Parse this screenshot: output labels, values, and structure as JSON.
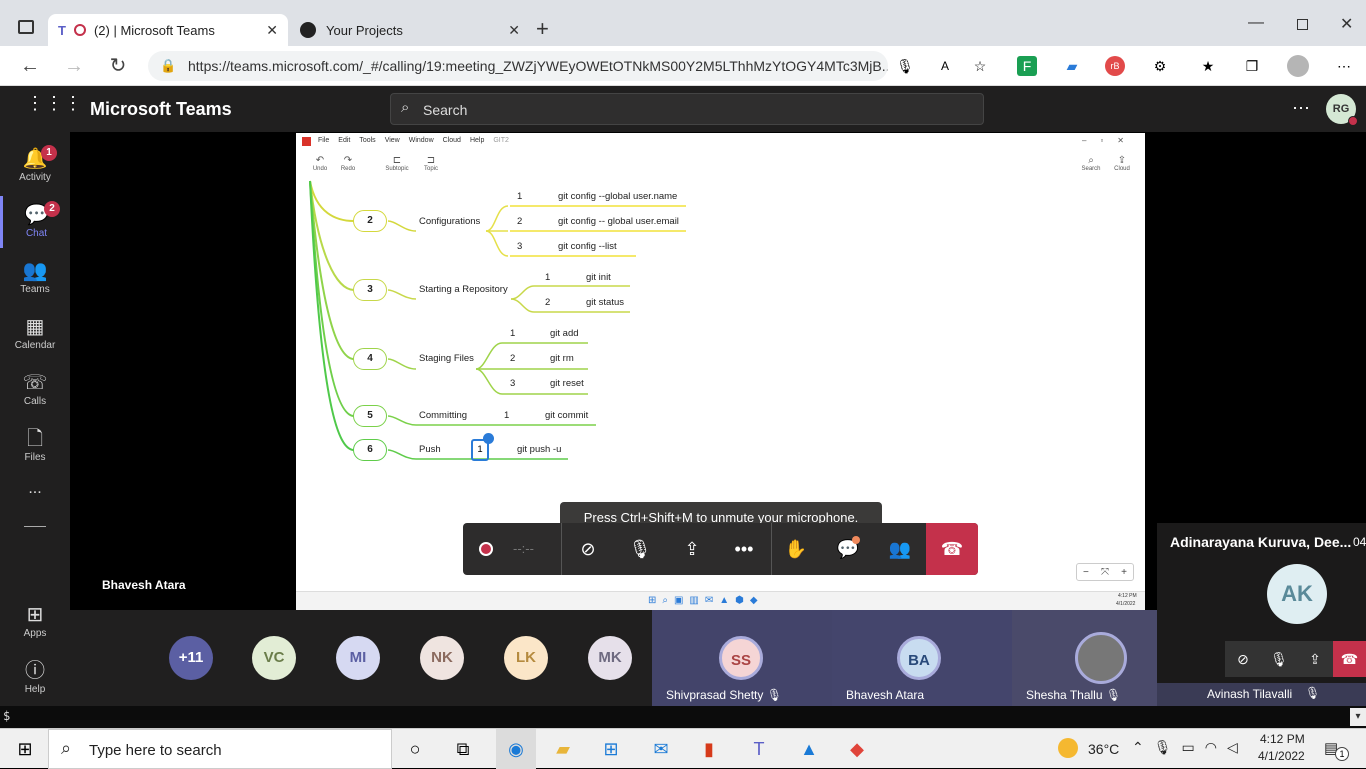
{
  "browser": {
    "tabs": [
      {
        "label": "(2) | Microsoft Teams"
      },
      {
        "label": "Your Projects"
      }
    ],
    "url": "https://teams.microsoft.com/_#/calling/19:meeting_ZWZjYWEyOWEtOTNkMS00Y2M5LThhMzYtOGY4MTc3MjB..."
  },
  "teams": {
    "app_title": "Microsoft Teams",
    "search_placeholder": "Search",
    "user_initials": "RG",
    "rail": [
      {
        "label": "Activity",
        "badge": "1"
      },
      {
        "label": "Chat",
        "badge": "2"
      },
      {
        "label": "Teams",
        "badge": ""
      },
      {
        "label": "Calendar",
        "badge": ""
      },
      {
        "label": "Calls",
        "badge": ""
      },
      {
        "label": "Files",
        "badge": ""
      },
      {
        "label": "...",
        "badge": ""
      },
      {
        "label": "Apps",
        "badge": ""
      },
      {
        "label": "Help",
        "badge": ""
      }
    ],
    "presenter_name": "Bhavesh Atara",
    "toast": "Press Ctrl+Shift+M to unmute your microphone.",
    "timer": "--:--",
    "participants_more": "+11",
    "avatars": [
      "VC",
      "MI",
      "NK",
      "LK",
      "MK"
    ],
    "video_tiles": [
      {
        "initials": "SS",
        "name": "Shivprasad Shetty"
      },
      {
        "initials": "BA",
        "name": "Bhavesh Atara"
      },
      {
        "initials": "",
        "name": "Shesha Thallu"
      }
    ],
    "side_panel": {
      "title": "Adinarayana Kuruva, Dee...",
      "time": "04",
      "initials": "AK",
      "name": "Avinash Tilavalli"
    },
    "terminal_prompt": "$"
  },
  "mindmap": {
    "menu": [
      "File",
      "Edit",
      "Tools",
      "View",
      "Window",
      "Cloud",
      "Help",
      "GIT2"
    ],
    "tools": [
      "Undo",
      "Redo",
      "Subtopic",
      "Topic",
      "Search",
      "Cloud"
    ],
    "clock": "4:12 PM",
    "date": "4/1/2022",
    "nodes": [
      {
        "num": "2",
        "label": "Configurations",
        "children": [
          {
            "num": "1",
            "label": "git config --global user.name"
          },
          {
            "num": "2",
            "label": "git config -- global user.email"
          },
          {
            "num": "3",
            "label": "git config --list"
          }
        ]
      },
      {
        "num": "3",
        "label": "Starting a Repository",
        "children": [
          {
            "num": "1",
            "label": "git init"
          },
          {
            "num": "2",
            "label": "git status"
          }
        ]
      },
      {
        "num": "4",
        "label": "Staging Files",
        "children": [
          {
            "num": "1",
            "label": "git add"
          },
          {
            "num": "2",
            "label": "git rm"
          },
          {
            "num": "3",
            "label": "git reset"
          }
        ]
      },
      {
        "num": "5",
        "label": "Committing",
        "children": [
          {
            "num": "1",
            "label": "git commit"
          }
        ]
      },
      {
        "num": "6",
        "label": "Push",
        "children": [
          {
            "num": "1",
            "label": "git push -u"
          }
        ]
      }
    ]
  },
  "taskbar": {
    "search_placeholder": "Type here to search",
    "temperature": "36°C",
    "time": "4:12 PM",
    "date": "4/1/2022",
    "notification_count": "1"
  },
  "colors": {
    "teams_bg": "#201f1f",
    "accent": "#6264a7",
    "hangup": "#c4314b",
    "mm_yellow": "#d4d83c",
    "mm_green": "#7bd14a"
  }
}
